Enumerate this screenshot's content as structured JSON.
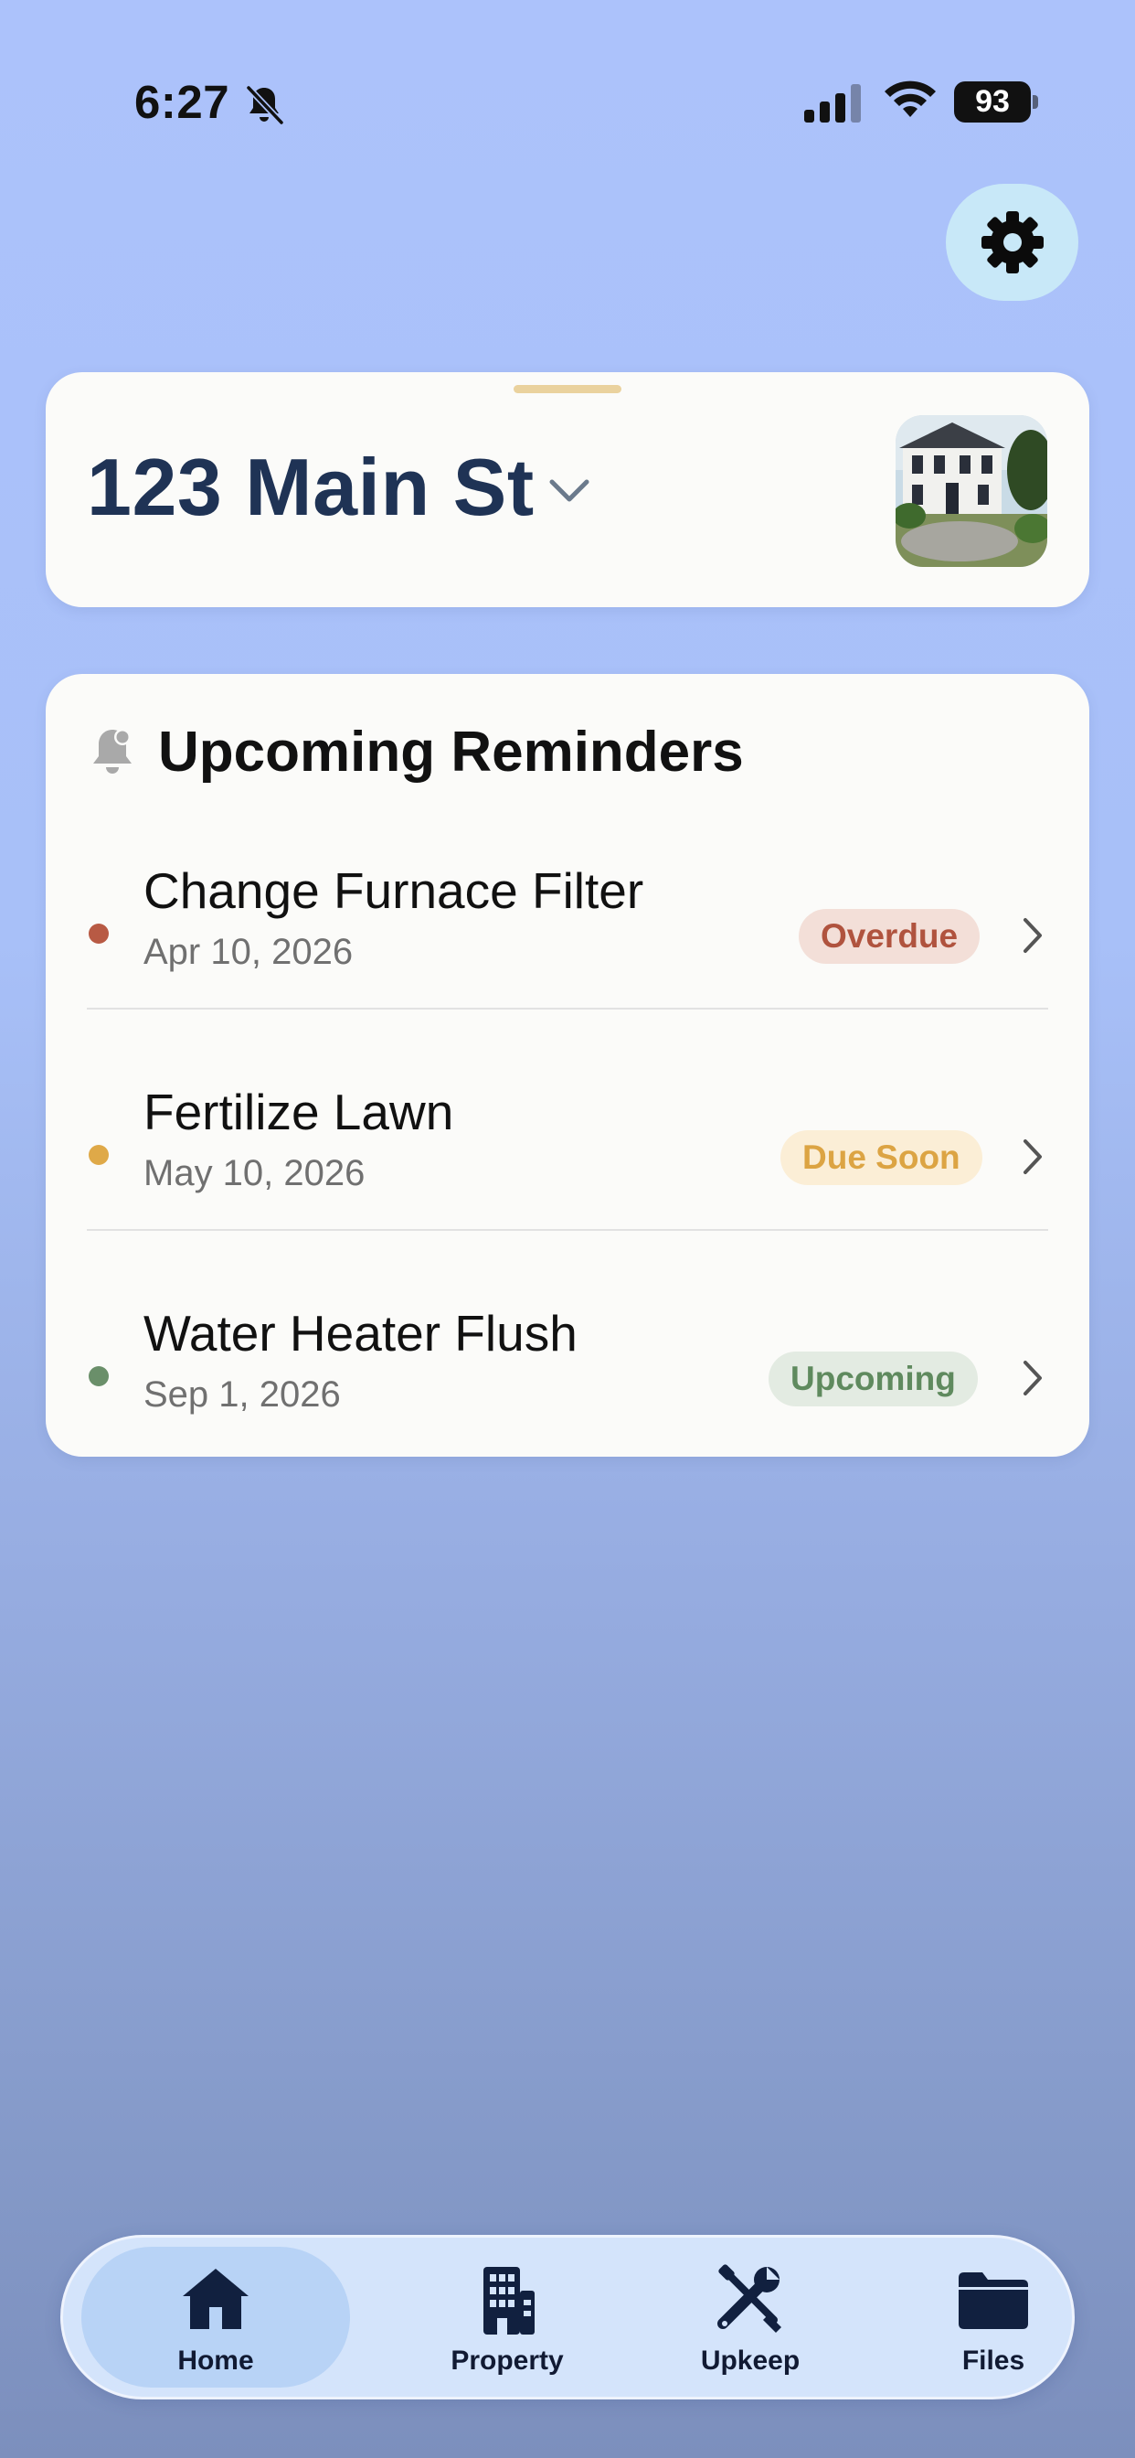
{
  "status_bar": {
    "time": "6:27",
    "battery": "93",
    "icons": [
      "bell-slash-icon",
      "signal-icon",
      "wifi-icon",
      "battery-icon"
    ]
  },
  "settings": {
    "icon": "gear-icon"
  },
  "address_card": {
    "address": "123 Main St",
    "dropdown_icon": "chevron-down-icon",
    "photo_icon": "house-photo"
  },
  "reminders": {
    "title": "Upcoming Reminders",
    "icon": "bell-icon",
    "items": [
      {
        "title": "Change Furnace Filter",
        "date": "Apr 10, 2026",
        "status": "Overdue",
        "dot_color": "#b85a44",
        "badge_bg": "#f3dfd8",
        "badge_fg": "#b0533e"
      },
      {
        "title": "Fertilize Lawn",
        "date": "May 10, 2026",
        "status": "Due Soon",
        "dot_color": "#dfa948",
        "badge_bg": "#fbeed6",
        "badge_fg": "#dca443"
      },
      {
        "title": "Water Heater Flush",
        "date": "Sep 1, 2026",
        "status": "Upcoming",
        "dot_color": "#6a8f6a",
        "badge_bg": "#e3ebe2",
        "badge_fg": "#5f8a5e"
      }
    ]
  },
  "tab_bar": {
    "tabs": [
      {
        "label": "Home",
        "icon": "house-icon",
        "active": true
      },
      {
        "label": "Property",
        "icon": "building-icon",
        "active": false
      },
      {
        "label": "Upkeep",
        "icon": "tools-icon",
        "active": false
      },
      {
        "label": "Files",
        "icon": "folder-icon",
        "active": false
      }
    ]
  },
  "colors": {
    "navy": "#1f3355",
    "tab_icon": "#11203f",
    "settings_bg": "#c8e8f8"
  }
}
